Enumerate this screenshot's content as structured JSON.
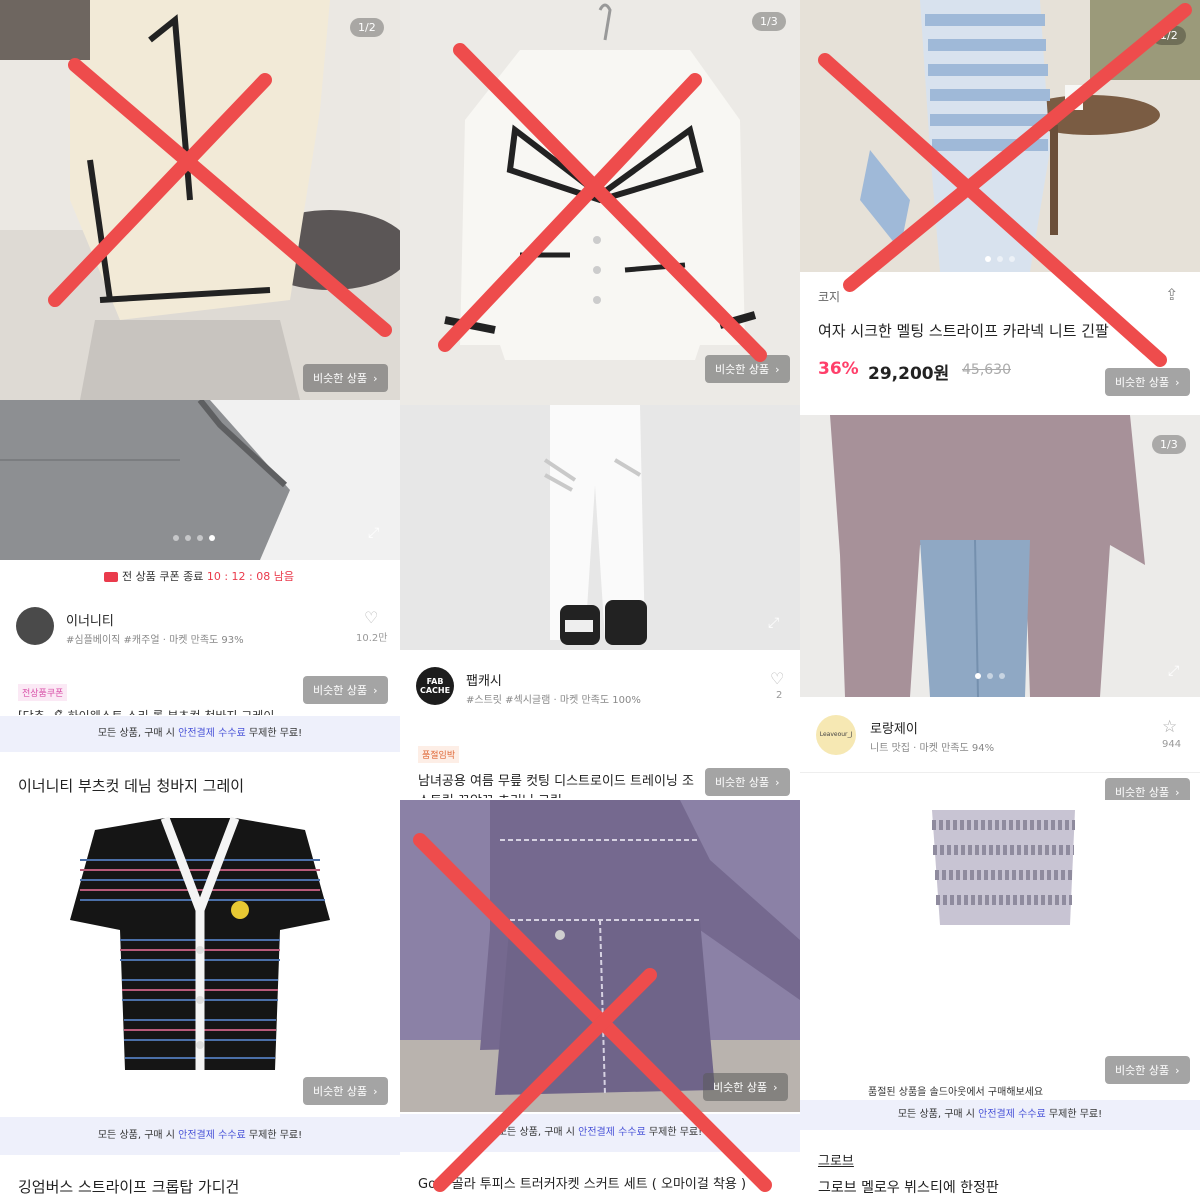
{
  "common": {
    "similar_label": "비슷한 상품",
    "banner_prefix": "모든 상품, 구매 시 ",
    "banner_highlight": "안전결제 수수료",
    "banner_suffix": " 무제한 무료!"
  },
  "tiles": {
    "t1": {
      "counter": "1/2"
    },
    "t2": {
      "counter": "1/3"
    },
    "t3": {
      "counter": "1/2",
      "seller": "코지",
      "title": "여자 시크한 멜팅 스트라이프 카라넥 니트 긴팔",
      "discount": "36%",
      "price": "29,200원",
      "original_price": "45,630"
    },
    "t4": {
      "coupon_prefix": "전 상품 쿠폰 종료 ",
      "coupon_timer": "10 : 12 : 08 남음",
      "shop_name": "이너니티",
      "shop_meta": "#심플베이직 #캐주얼 · 마켓 만족도 93%",
      "likes": "10.2만",
      "badge": "전상품쿠폰",
      "partial_line": "[단추 🖋 하이웨스트 스리 롤 부츠컷 청바지 그레이",
      "title": "이너니티 부츠컷 데님 청바지 그레이"
    },
    "t5": {
      "logo": "FAB CACHE",
      "shop_name": "팹캐시",
      "shop_meta": "#스트릿 #섹시글램 · 마켓 만족도 100%",
      "likes": "2",
      "badge": "품절임박",
      "title_line1": "남녀공용 여름 무릎 컷팅 디스트로이드 트레이닝 조",
      "title_line2": "스트링 꼬앞꼬 츠리닝 크림"
    },
    "t6": {
      "counter": "1/3",
      "logo": "Leaveour_J",
      "shop_name": "로랑제이",
      "shop_meta": "니트 맛집 · 마켓 만족도 94%",
      "likes": "944"
    },
    "t7": {
      "title": "깅엄버스 스트라이프 크롭탑 가디건"
    },
    "t8": {
      "title": "Gola 골라 투피스 트러커자켓 스커트 세트 ( 오마이걸 착용 )"
    },
    "t9": {
      "notice": "품절된 상품을 솔드아웃에서 구매해보세요",
      "shop_name": "그로브",
      "title": "그로브 멜로우 뷔스티에 한정판"
    }
  },
  "colors": {
    "cross": "#ee4c4c",
    "discount": "#ff3f6a",
    "banner_bg": "#eef0fb",
    "banner_highlight": "#4a54d8"
  }
}
